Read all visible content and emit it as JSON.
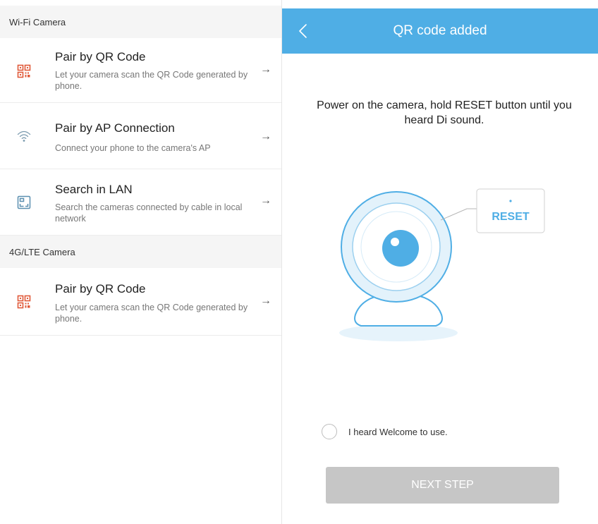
{
  "left_screen": {
    "wifi_section": {
      "header": "Wi-Fi Camera"
    },
    "options": [
      {
        "title": "Pair by QR Code",
        "desc": "Let your camera scan the QR Code generated by phone.",
        "icon": "qr-code-icon",
        "arrow": "→"
      },
      {
        "title": "Pair by AP Connection",
        "desc": "Connect your phone to the camera's AP",
        "icon": "wifi-icon",
        "arrow": "→"
      },
      {
        "title": "Search in LAN",
        "desc": "Search the cameras connected by cable in local network",
        "icon": "lan-icon",
        "arrow": "→"
      }
    ],
    "lte_section": {
      "header": "4G/LTE Camera"
    },
    "lte_options": [
      {
        "title": "Pair by QR Code",
        "desc": "Let your camera scan the QR Code generated by phone.",
        "icon": "qr-code-icon",
        "arrow": "→"
      }
    ]
  },
  "right_screen": {
    "appbar": {
      "title": "QR code added",
      "back_icon": "chevron-left-icon"
    },
    "instruction": "Power on the camera, hold RESET button until you heard Di sound.",
    "illustration": {
      "reset_label": "RESET"
    },
    "confirm": {
      "label": "I heard Welcome to use.",
      "checked": false
    },
    "next_button": "NEXT STEP"
  },
  "colors": {
    "accent": "#4faee5",
    "qr_icon": "#e05a3a",
    "line_icon": "#5a8fb0",
    "disabled_button": "#c6c6c6",
    "section_bg": "#f5f5f5"
  }
}
